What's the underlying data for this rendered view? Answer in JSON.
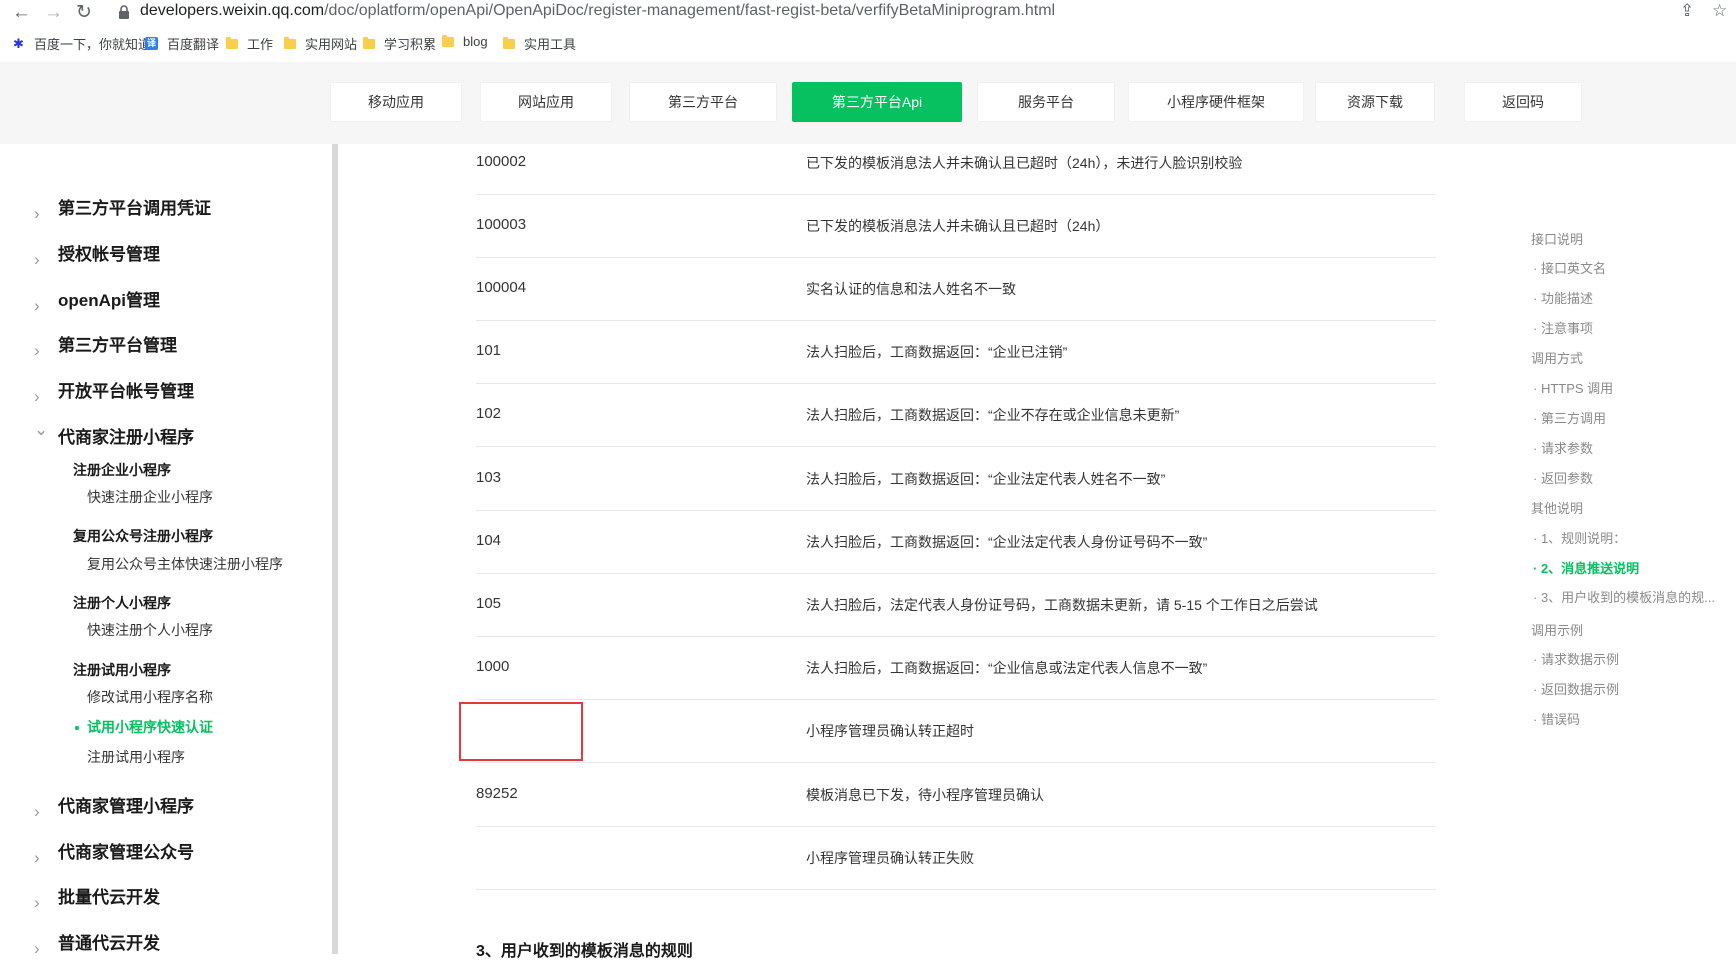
{
  "browser": {
    "url_domain": "developers.weixin.qq.com",
    "url_path": "/doc/oplatform/openApi/OpenApiDoc/register-management/fast-regist-beta/verfifyBetaMiniprogram.html",
    "bookmarks": [
      {
        "label": "百度一下，你就知道",
        "icon": "baidu-icon"
      },
      {
        "label": "百度翻译",
        "icon": "translate-icon"
      },
      {
        "label": "工作",
        "icon": "folder-icon"
      },
      {
        "label": "实用网站",
        "icon": "folder-icon"
      },
      {
        "label": "学习积累",
        "icon": "folder-icon"
      },
      {
        "label": "blog",
        "icon": "folder-icon"
      },
      {
        "label": "实用工具",
        "icon": "folder-icon"
      }
    ]
  },
  "topnav": {
    "items": [
      "移动应用",
      "网站应用",
      "第三方平台",
      "第三方平台Api",
      "服务平台",
      "小程序硬件框架",
      "资源下载",
      "返回码"
    ],
    "active_index": 3,
    "accent": "#07c160"
  },
  "sidebar": {
    "groups_top": [
      "第三方平台调用凭证",
      "授权帐号管理",
      "openApi管理",
      "第三方平台管理",
      "开放平台帐号管理"
    ],
    "expanded_group": "代商家注册小程序",
    "subsections": [
      {
        "title": "注册企业小程序",
        "items": [
          "快速注册企业小程序"
        ]
      },
      {
        "title": "复用公众号注册小程序",
        "items": [
          "复用公众号主体快速注册小程序"
        ]
      },
      {
        "title": "注册个人小程序",
        "items": [
          "快速注册个人小程序"
        ]
      },
      {
        "title": "注册试用小程序",
        "items": [
          "修改试用小程序名称",
          "试用小程序快速认证",
          "注册试用小程序"
        ]
      }
    ],
    "active_item": "试用小程序快速认证",
    "groups_bottom": [
      "代商家管理小程序",
      "代商家管理公众号",
      "批量代云开发",
      "普通代云开发"
    ]
  },
  "table": {
    "rows": [
      {
        "code": "100002",
        "desc": "已下发的模板消息法人并未确认且已超时（24h），未进行人脸识别校验"
      },
      {
        "code": "100003",
        "desc": "已下发的模板消息法人并未确认且已超时（24h）"
      },
      {
        "code": "100004",
        "desc": "实名认证的信息和法人姓名不一致"
      },
      {
        "code": "101",
        "desc": "法人扫脸后，工商数据返回：“企业已注销”"
      },
      {
        "code": "102",
        "desc": "法人扫脸后，工商数据返回：“企业不存在或企业信息未更新”"
      },
      {
        "code": "103",
        "desc": "法人扫脸后，工商数据返回：“企业法定代表人姓名不一致”"
      },
      {
        "code": "104",
        "desc": "法人扫脸后，工商数据返回：“企业法定代表人身份证号码不一致”"
      },
      {
        "code": "105",
        "desc": "法人扫脸后，法定代表人身份证号码，工商数据未更新，请 5-15 个工作日之后尝试"
      },
      {
        "code": "1000",
        "desc": "法人扫脸后，工商数据返回：“企业信息或法定代表人信息不一致”"
      },
      {
        "code": "",
        "desc": "小程序管理员确认转正超时"
      },
      {
        "code": "89252",
        "desc": "模板消息已下发，待小程序管理员确认"
      },
      {
        "code": "",
        "desc": "小程序管理员确认转正失败"
      }
    ]
  },
  "section_heading": "3、用户收到的模板消息的规则",
  "toc": {
    "items": [
      {
        "label": "接口说明",
        "level": 1
      },
      {
        "label": "· 接口英文名",
        "level": 2
      },
      {
        "label": "· 功能描述",
        "level": 2
      },
      {
        "label": "· 注意事项",
        "level": 2
      },
      {
        "label": "调用方式",
        "level": 1
      },
      {
        "label": "· HTTPS 调用",
        "level": 2
      },
      {
        "label": "· 第三方调用",
        "level": 2
      },
      {
        "label": "· 请求参数",
        "level": 2
      },
      {
        "label": "· 返回参数",
        "level": 2
      },
      {
        "label": "其他说明",
        "level": 1
      },
      {
        "label": "· 1、规则说明：",
        "level": 2
      },
      {
        "label": "· 2、消息推送说明",
        "level": 2
      },
      {
        "label": "· 3、用户收到的模板消息的规...",
        "level": 2
      },
      {
        "label": "调用示例",
        "level": 1
      },
      {
        "label": "· 请求数据示例",
        "level": 2
      },
      {
        "label": "· 返回数据示例",
        "level": 2
      },
      {
        "label": "· 错误码",
        "level": 2
      }
    ],
    "active_index": 11
  }
}
